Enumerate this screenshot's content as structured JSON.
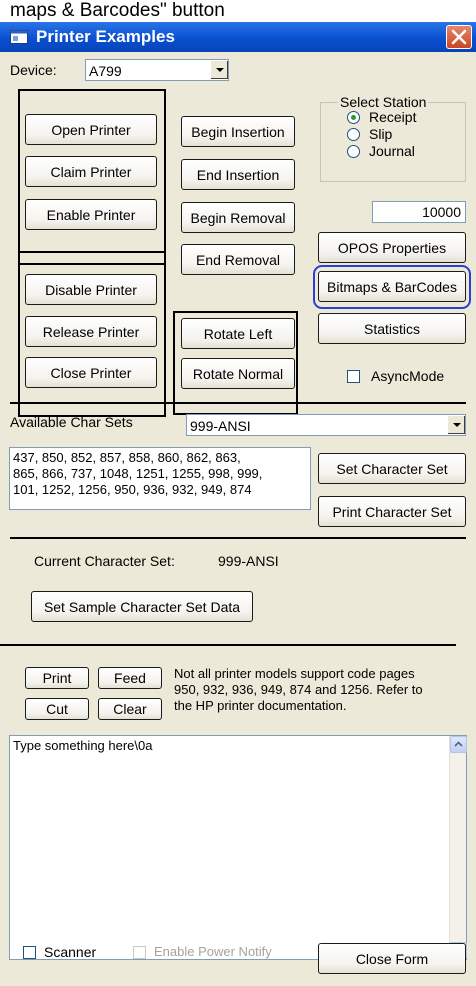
{
  "caption": "maps & Barcodes\" button",
  "window": {
    "title": "Printer Examples",
    "device_label": "Device:",
    "device_value": "A799"
  },
  "buttons": {
    "open_printer": "Open Printer",
    "claim_printer": "Claim Printer",
    "enable_printer": "Enable Printer",
    "disable_printer": "Disable Printer",
    "release_printer": "Release Printer",
    "close_printer": "Close Printer",
    "begin_insertion": "Begin Insertion",
    "end_insertion": "End Insertion",
    "begin_removal": "Begin Removal",
    "end_removal": "End Removal",
    "rotate_left": "Rotate Left",
    "rotate_normal": "Rotate Normal",
    "opos_properties": "OPOS Properties",
    "bitmaps_barcodes": "Bitmaps & BarCodes",
    "statistics": "Statistics"
  },
  "station": {
    "legend": "Select Station",
    "receipt": "Receipt",
    "slip": "Slip",
    "journal": "Journal",
    "selected": "Receipt"
  },
  "timeout_value": "10000",
  "async_mode_label": "AsyncMode",
  "charsets": {
    "available_label": "Available Char Sets",
    "selected": "999-ANSI",
    "list_lines": [
      "437, 850, 852, 857, 858, 860, 862, 863,",
      "865, 866, 737, 1048, 1251, 1255, 998, 999,",
      "101, 1252, 1256, 950, 936, 932, 949, 874"
    ],
    "set_button": "Set Character Set",
    "print_button": "Print Character Set",
    "current_label": "Current Character Set:",
    "current_value": "999-ANSI",
    "sample_button": "Set Sample Character Set Data"
  },
  "actions": {
    "print": "Print",
    "feed": "Feed",
    "cut": "Cut",
    "clear": "Clear",
    "note_lines": [
      "Not all printer models support code pages",
      "950, 932, 936, 949, 874 and 1256. Refer to",
      "the HP printer documentation."
    ]
  },
  "text_area_value": "Type something here\\0a",
  "bottom": {
    "scanner_label": "Scanner",
    "power_notify_label": "Enable Power Notify",
    "close_form": "Close Form"
  }
}
